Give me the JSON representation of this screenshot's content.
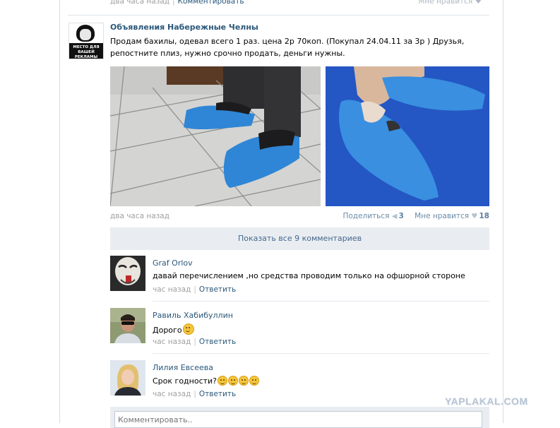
{
  "previous_post": {
    "time": "два часа назад",
    "comment_link": "Комментировать",
    "like_label": "Мне нравится"
  },
  "post": {
    "avatar_caption": "МЕСТО ДЛЯ ВАШЕЙ РЕКЛАМЫ",
    "group_name": "Объявления Набережные Челны",
    "text": "Продам бахилы, одевал всего 1 раз. цена 2р 70коп. (Покупал 24.04.11 за 3р ) Друзья, репостните плиз, нужно срочно продать, деньги нужны.",
    "time": "два часа назад",
    "share_label": "Поделиться",
    "share_count": "3",
    "like_label": "Мне нравится",
    "like_count": "18"
  },
  "show_all_comments": "Показать все 9 комментариев",
  "comments": [
    {
      "author": "Graf Orlov",
      "text": "давай перечислением ,но средства проводим только на офшорной стороне",
      "time": "час назад",
      "reply": "Ответить"
    },
    {
      "author": "Равиль Хабибуллин",
      "text": "Дорого",
      "time": "час назад",
      "reply": "Ответить"
    },
    {
      "author": "Лилия Евсеева",
      "text": "Срок годности?",
      "time": "час назад",
      "reply": "Ответить"
    }
  ],
  "comment_input": {
    "placeholder": "Комментировать.."
  },
  "watermark": "YAPLAKAL.COM",
  "icons": {
    "heart": "heart-icon",
    "megaphone": "megaphone-icon",
    "emoji": "smiley-emoji-icon"
  },
  "colors": {
    "link": "#2b587a",
    "meta": "#a0a0a0",
    "show_all_bg": "#e9edf1",
    "shoe_cover": "#2f86d6"
  }
}
